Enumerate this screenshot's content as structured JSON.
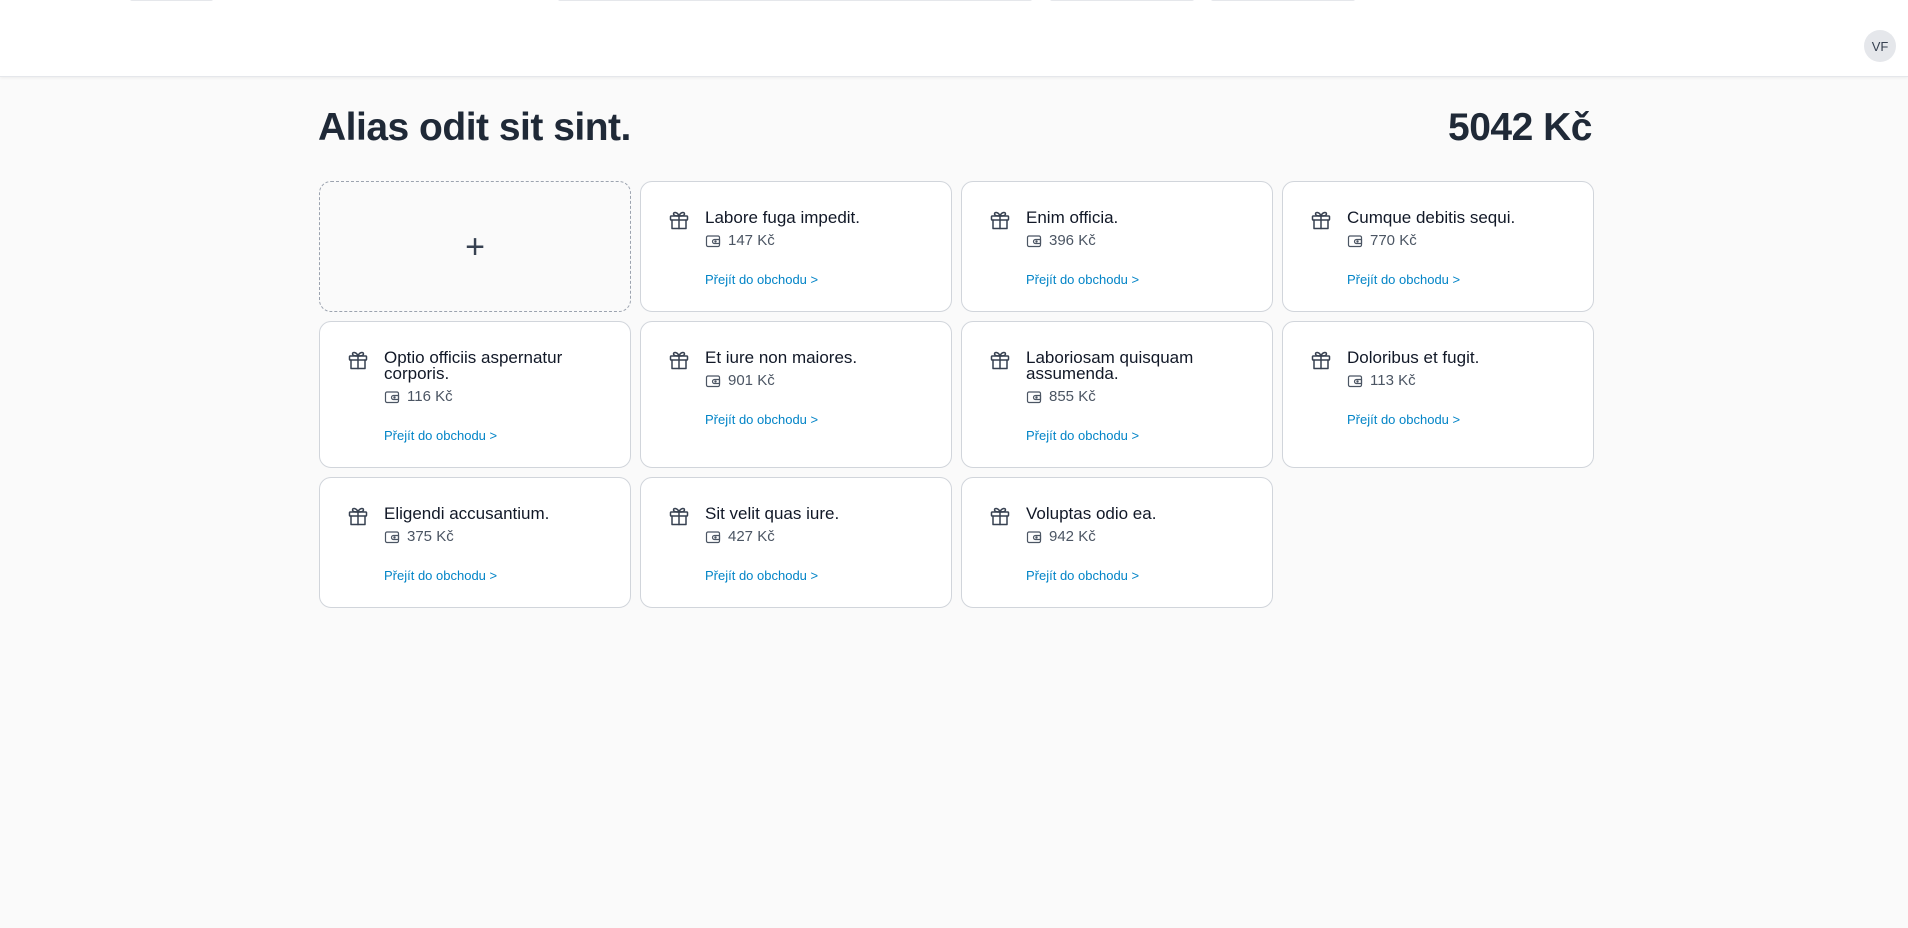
{
  "header": {
    "avatar_initials": "VF"
  },
  "page": {
    "title": "Alias odit sit sint.",
    "total": "5042 Kč"
  },
  "add_card": {
    "symbol": "+"
  },
  "cards": [
    {
      "name": "Labore fuga impedit.",
      "price": "147 Kč",
      "link": "Přejít do obchodu >"
    },
    {
      "name": "Enim officia.",
      "price": "396 Kč",
      "link": "Přejít do obchodu >"
    },
    {
      "name": "Cumque debitis sequi.",
      "price": "770 Kč",
      "link": "Přejít do obchodu >"
    },
    {
      "name": "Optio officiis aspernatur corporis.",
      "price": "116 Kč",
      "link": "Přejít do obchodu >"
    },
    {
      "name": "Et iure non maiores.",
      "price": "901 Kč",
      "link": "Přejít do obchodu >"
    },
    {
      "name": "Laboriosam quisquam assumenda.",
      "price": "855 Kč",
      "link": "Přejít do obchodu >"
    },
    {
      "name": "Doloribus et fugit.",
      "price": "113 Kč",
      "link": "Přejít do obchodu >"
    },
    {
      "name": "Eligendi accusantium.",
      "price": "375 Kč",
      "link": "Přejít do obchodu >"
    },
    {
      "name": "Sit velit quas iure.",
      "price": "427 Kč",
      "link": "Přejít do obchodu >"
    },
    {
      "name": "Voluptas odio ea.",
      "price": "942 Kč",
      "link": "Přejít do obchodu >"
    }
  ],
  "icons": {
    "card_icon": "gift-icon",
    "price_icon": "wallet-icon"
  },
  "colors": {
    "link": "#0284c7",
    "title": "#1f2937",
    "background": "#fafafa"
  }
}
